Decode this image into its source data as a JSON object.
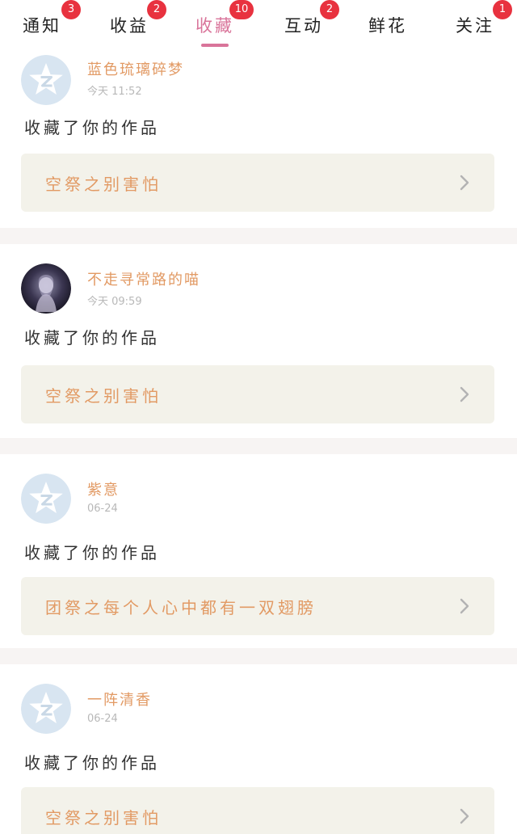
{
  "tabs": [
    {
      "label": "通知",
      "badge": "3",
      "active": false
    },
    {
      "label": "收益",
      "badge": "2",
      "active": false
    },
    {
      "label": "收藏",
      "badge": "10",
      "active": true
    },
    {
      "label": "互动",
      "badge": "2",
      "active": false
    },
    {
      "label": "鲜花",
      "badge": "",
      "active": false
    },
    {
      "label": "关注",
      "badge": "1",
      "active": false
    }
  ],
  "colors": {
    "accent": "#d9749a",
    "badge": "#e8323f",
    "name": "#e29a64",
    "work_bg": "#f3f2ea"
  },
  "feed": [
    {
      "avatar": "qzone-default-avatar-icon",
      "name": "蓝色琉璃碎梦",
      "time": "今天 11:52",
      "action": "收藏了你的作品",
      "work_title": "空祭之别害怕"
    },
    {
      "avatar": "user-photo-avatar",
      "name": "不走寻常路的喵",
      "time": "今天 09:59",
      "action": "收藏了你的作品",
      "work_title": "空祭之别害怕"
    },
    {
      "avatar": "qzone-default-avatar-icon",
      "name": "紫意",
      "time": "06-24",
      "action": "收藏了你的作品",
      "work_title": "团祭之每个人心中都有一双翅膀"
    },
    {
      "avatar": "qzone-default-avatar-icon",
      "name": "一阵清香",
      "time": "06-24",
      "action": "收藏了你的作品",
      "work_title": "空祭之别害怕"
    }
  ]
}
